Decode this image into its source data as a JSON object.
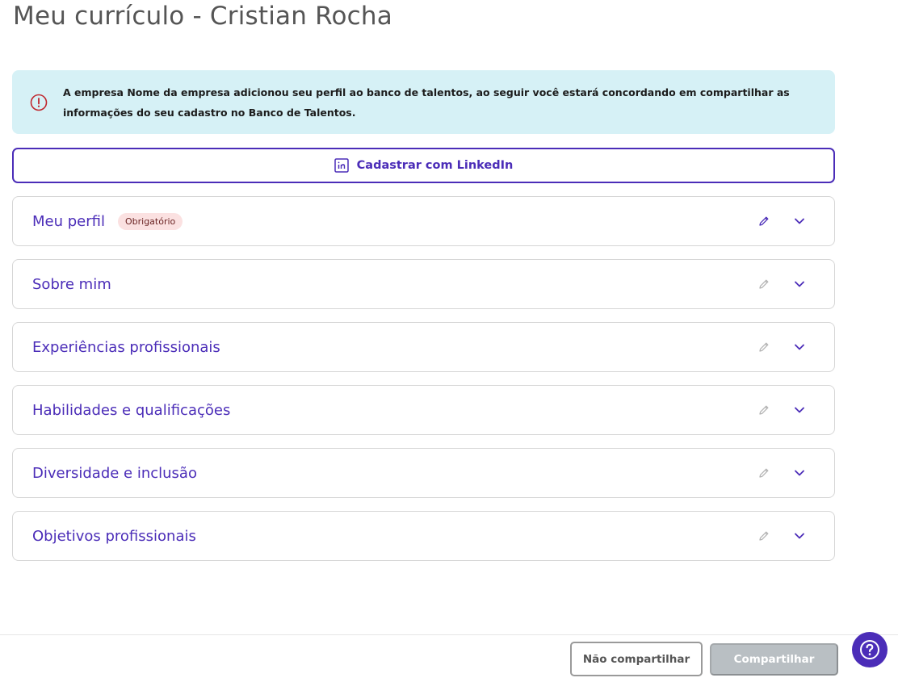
{
  "page": {
    "title": "Meu currículo - Cristian Rocha"
  },
  "banner": {
    "icon": "info-circle-icon",
    "text": "A empresa Nome da empresa adicionou seu perfil ao banco de talentos, ao seguir você estará concordando em compartilhar as informações do seu cadastro no Banco de Talentos.",
    "color": "#d6f1f6"
  },
  "linkedin": {
    "label": "Cadastrar com LinkedIn",
    "icon": "linkedin-icon"
  },
  "sections": [
    {
      "title": "Meu perfil",
      "badge": "Obrigatório"
    },
    {
      "title": "Sobre mim"
    },
    {
      "title": "Experiências profissionais"
    },
    {
      "title": "Habilidades e qualificações"
    },
    {
      "title": "Diversidade e inclusão"
    },
    {
      "title": "Objetivos profissionais"
    }
  ],
  "footer": {
    "decline_label": "Não compartilhar",
    "share_label": "Compartilhar",
    "help_icon": "help-circle-icon"
  },
  "colors": {
    "accent": "#4b2db8",
    "badge_bg": "#fbe1e1",
    "disabled_button": "#b9bfc3"
  }
}
